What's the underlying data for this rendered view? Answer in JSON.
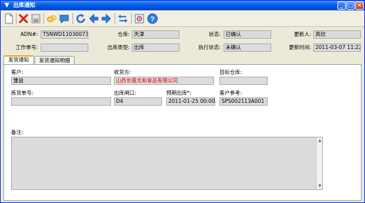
{
  "window": {
    "title": "出库通知"
  },
  "toolbar": {
    "icons": [
      "new-document-icon",
      "delete-icon",
      "save-icon",
      "link-icon",
      "comment-icon",
      "refresh-icon",
      "back-arrow-icon",
      "forward-arrow-icon",
      "swap-icon",
      "settings-icon",
      "help-icon"
    ]
  },
  "header": {
    "adn_label": "ADN#:",
    "adn_value": "TSNWD11030073",
    "warehouse_label": "仓库:",
    "warehouse_value": "天津",
    "status_label": "状态:",
    "status_value": "已确认",
    "updater_label": "更新人:",
    "updater_value": "高欣",
    "work_order_label": "工作单号:",
    "work_order_value": "",
    "outbound_type_label": "出库类型:",
    "outbound_type_value": "出库",
    "exec_status_label": "执行状态:",
    "exec_status_value": "未确认",
    "update_time_label": "更新时间:",
    "update_time_value": "2011-03-07 11:22"
  },
  "tabs": [
    {
      "label": "发货通知"
    },
    {
      "label": "发货通知明细"
    }
  ],
  "detail": {
    "customer_label": "客户:",
    "customer_value": "雏益",
    "consignee_label": "收货方:",
    "consignee_value": "山西长盛太和食品有限公司",
    "target_wh_label": "目标仓库:",
    "target_wh_value": "",
    "pick_no_label": "拣货单号:",
    "pick_no_value": "",
    "exit_label": "出库闸口:",
    "exit_value": "D4",
    "expected_label": "预期出库*:",
    "expected_value": "2011-01-25 00:00",
    "cust_ref_label": "客户参考:",
    "cust_ref_value": "SPS002113A001",
    "remark_label": "备注:",
    "remark_value": ""
  },
  "colors": {
    "titlebar": "#0054e3",
    "window_bg": "#ece9d8",
    "field_bg": "#dcdcdc",
    "consignee_text": "#e00000",
    "active_tab_accent": "#f5a623"
  }
}
